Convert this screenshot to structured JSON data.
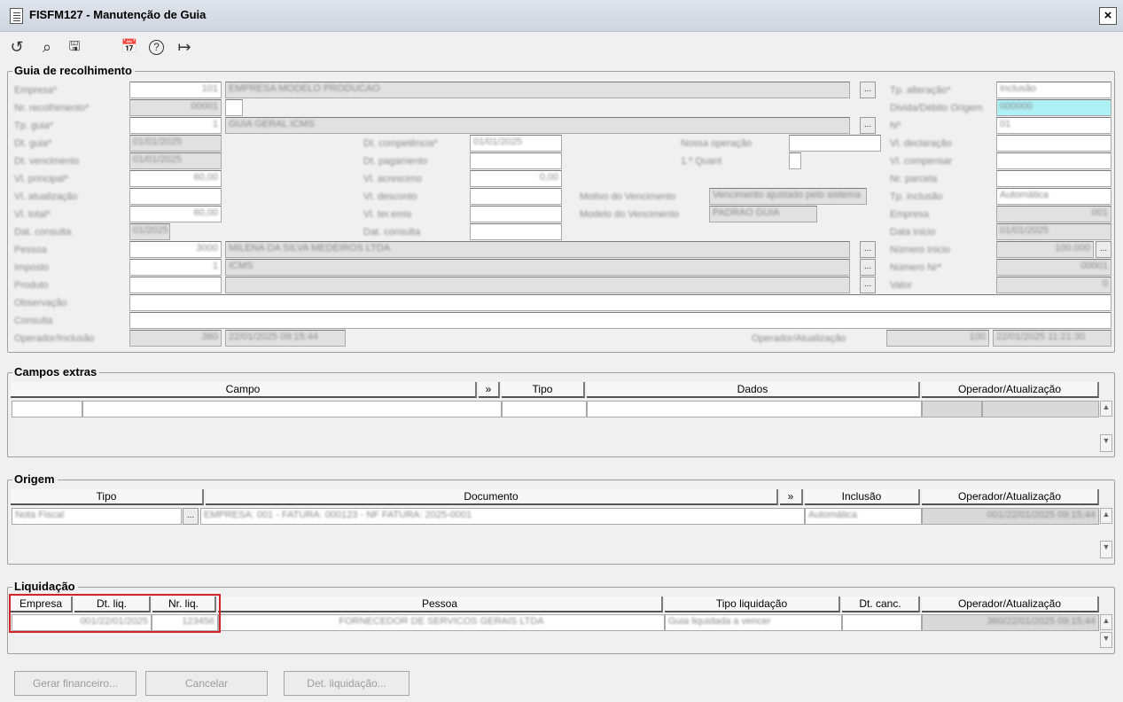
{
  "window": {
    "title": "FISFM127 - Manutenção de Guia",
    "close_label": "×"
  },
  "toolbar": {
    "icons": [
      "undo-icon",
      "search-icon",
      "save-icon",
      "calendar-icon",
      "help-icon",
      "exit-icon"
    ],
    "glyphs": {
      "undo": "↺",
      "search": "⌕",
      "save": "🖫",
      "calendar": "📅",
      "help": "?",
      "exit": "↦"
    }
  },
  "guia": {
    "group_title": "Guia de recolhimento",
    "labels": {
      "l1": "Empresa*",
      "l2": "Nr. recolhimento*",
      "l3": "Tp. guia*",
      "l4": "Dt. guia*",
      "l5": "Dt. vencimento",
      "l6": "Vl. principal*",
      "l7": "Vl. atualização",
      "l8": "Vl. total*",
      "l9": "Dat. consulta",
      "l10": "Pessoa",
      "l11": "Imposto",
      "l12": "Produto",
      "l13": "Observação",
      "l14": "Consulta",
      "l15": "Operador/Inclusão",
      "m1": "Dt. competência*",
      "m2": "Dt. pagamento",
      "m3": "Vl. acrescimo",
      "m4": "Vl. desconto",
      "m5": "Vl. ter.emis",
      "m6": "Dat. consulta",
      "n1": "Nossa operação",
      "n2": "1.º Quant",
      "n3": "Motivo do Vencimento",
      "n4": "Modelo do Vencimento",
      "op_upd": "Operador/Atualização",
      "r1": "Tp. alteração*",
      "r2": "Divida/Débito Origem",
      "r3": "Nº",
      "r4": "Vl. declaração",
      "r5": "Vl. compensar",
      "r6": "Nr. parcela",
      "r7": "Tp. inclusão",
      "r8": "Empresa",
      "r9": "Data inicio",
      "r10": "Número Inicio",
      "r11": "Número Nr*",
      "r12": "Valor"
    },
    "values": {
      "empresa_cod": "101",
      "empresa_nome": "EMPRESA MODELO PRODUCAO",
      "nr_rec": "00001",
      "tp_guia_cod": "1",
      "tp_guia_nome": "GUIA GERAL ICMS",
      "dt_guia": "01/01/2025",
      "dt_venc": "01/01/2025",
      "vl_principal": "60,00",
      "vl_total": "60,00",
      "dat_consulta": "01/2025",
      "dt_comp": "01/01/2025",
      "vl_acresc": "0,00",
      "pessoa_cod": "3000",
      "pessoa_nome": "MILENA DA SILVA MEDEIROS LTDA",
      "imposto_cod": "1",
      "imposto_nome": "ICMS",
      "motivo": "Vencimento ajustado pelo sistema",
      "modelo": "PADRAO GUIA",
      "r1": "Inclusão",
      "r2": "000000",
      "r3": "01",
      "r7": "Automática",
      "r8": "001",
      "r9": "01/01/2025",
      "r10": "100.000",
      "r11": "00001",
      "r12": "0",
      "op_inc_cod": "360",
      "op_inc_dt": "22/01/2025 09:15:44",
      "op_upd_cod": "100",
      "op_upd_dt": "22/01/2025 11:21:30"
    }
  },
  "extras": {
    "group_title": "Campos extras",
    "headers": {
      "campo": "Campo",
      "more": "»",
      "tipo": "Tipo",
      "dados": "Dados",
      "op": "Operador/Atualização"
    }
  },
  "origem": {
    "group_title": "Origem",
    "headers": {
      "tipo": "Tipo",
      "doc": "Documento",
      "more": "»",
      "inclusao": "Inclusão",
      "op": "Operador/Atualização"
    },
    "row": {
      "tipo": "Nota Fiscal",
      "doc": "EMPRESA: 001 - FATURA: 000123 - NF FATURA: 2025-0001",
      "inclusao": "Automática",
      "op": "001/22/01/2025 09:15:44"
    }
  },
  "liquidacao": {
    "group_title": "Liquidação",
    "headers": {
      "empresa": "Empresa",
      "dt": "Dt. liq.",
      "nr": "Nr. liq.",
      "pessoa": "Pessoa",
      "tipo": "Tipo liquidação",
      "canc": "Dt. canc.",
      "op": "Operador/Atualização"
    },
    "row": {
      "empresa": "001/22/01/2025",
      "nr": "123456",
      "pessoa": "FORNECEDOR DE SERVICOS GERAIS LTDA",
      "tipo": "Guia liquidada a vencer",
      "canc": "",
      "op": "360/22/01/2025 09:15:44"
    }
  },
  "buttons": {
    "gerar": "Gerar financeiro...",
    "cancelar": "Cancelar",
    "det": "Det. liquidação..."
  },
  "scroll": {
    "up": "▲",
    "down": "▼"
  },
  "colors": {
    "highlight": "#d2232a",
    "cyan_field": "#aef0f4"
  }
}
